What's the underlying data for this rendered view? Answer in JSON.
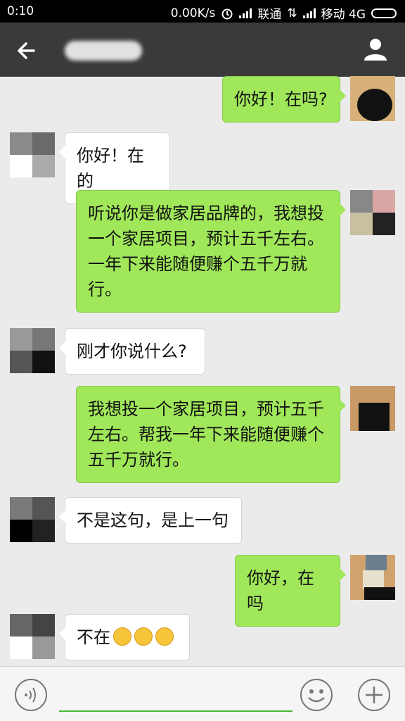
{
  "status_bar": {
    "time": "0:10",
    "speed": "0.00K/s",
    "carrier1": "联通",
    "carrier2": "移动 4G"
  },
  "nav": {
    "back_icon": "back-arrow-icon",
    "profile_icon": "person-icon"
  },
  "messages": [
    {
      "side": "out",
      "text": "你好！在吗?"
    },
    {
      "side": "in",
      "text": "你好！在的"
    },
    {
      "side": "out",
      "text": "听说你是做家居品牌的，我想投一个家居项目，预计五千左右。一年下来能随便赚个五千万就行。"
    },
    {
      "side": "in",
      "text": "刚才你说什么?"
    },
    {
      "side": "out",
      "text": "我想投一个家居项目，预计五千左右。帮我一年下来能随便赚个五千万就行。"
    },
    {
      "side": "in",
      "text": "不是这句，是上一句"
    },
    {
      "side": "out",
      "text": "你好，在吗"
    },
    {
      "side": "in",
      "text": "不在",
      "emoji": [
        "thinking-emoji",
        "thinking-emoji",
        "thinking-emoji"
      ]
    }
  ],
  "input_bar": {
    "value": "",
    "voice_icon": "voice-icon",
    "emoji_icon": "smiley-icon",
    "plus_icon": "plus-icon"
  },
  "colors": {
    "outgoing_bubble": "#a0e75a",
    "incoming_bubble": "#ffffff",
    "nav_bg": "#3a3a3a",
    "chat_bg": "#ebebeb",
    "input_underline": "#4cb53a"
  }
}
